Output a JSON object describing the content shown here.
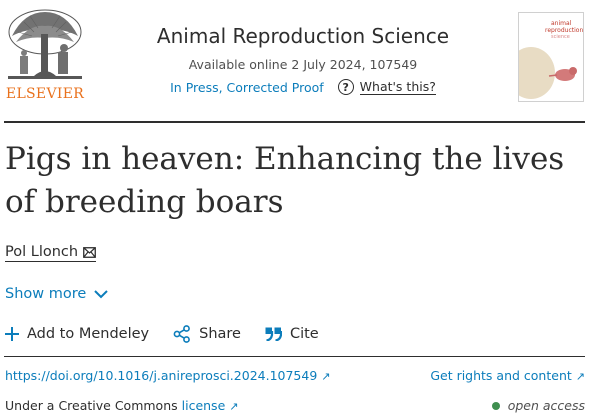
{
  "header": {
    "publisher": "ELSEVIER",
    "journal_title": "Animal Reproduction Science",
    "available_online": "Available online 2 July 2024, 107549",
    "status": "In Press, Corrected Proof",
    "whats_this": "What's this?"
  },
  "cover": {
    "journal_name_line1": "animal",
    "journal_name_line2": "reproduction",
    "journal_name_line3": "science"
  },
  "article": {
    "title": "Pigs in heaven: Enhancing the lives of breeding boars",
    "author": "Pol Llonch",
    "show_more": "Show more"
  },
  "actions": {
    "mendeley": "Add to Mendeley",
    "share": "Share",
    "cite": "Cite"
  },
  "links": {
    "doi": "https://doi.org/10.1016/j.anireprosci.2024.107549",
    "rights": "Get rights and content",
    "license_prefix": "Under a Creative Commons",
    "license_link": "license",
    "open_access": "open access"
  },
  "colors": {
    "link": "#0c7dbb",
    "publisher_orange": "#e9711c",
    "open_access_green": "#3f8f4f"
  }
}
